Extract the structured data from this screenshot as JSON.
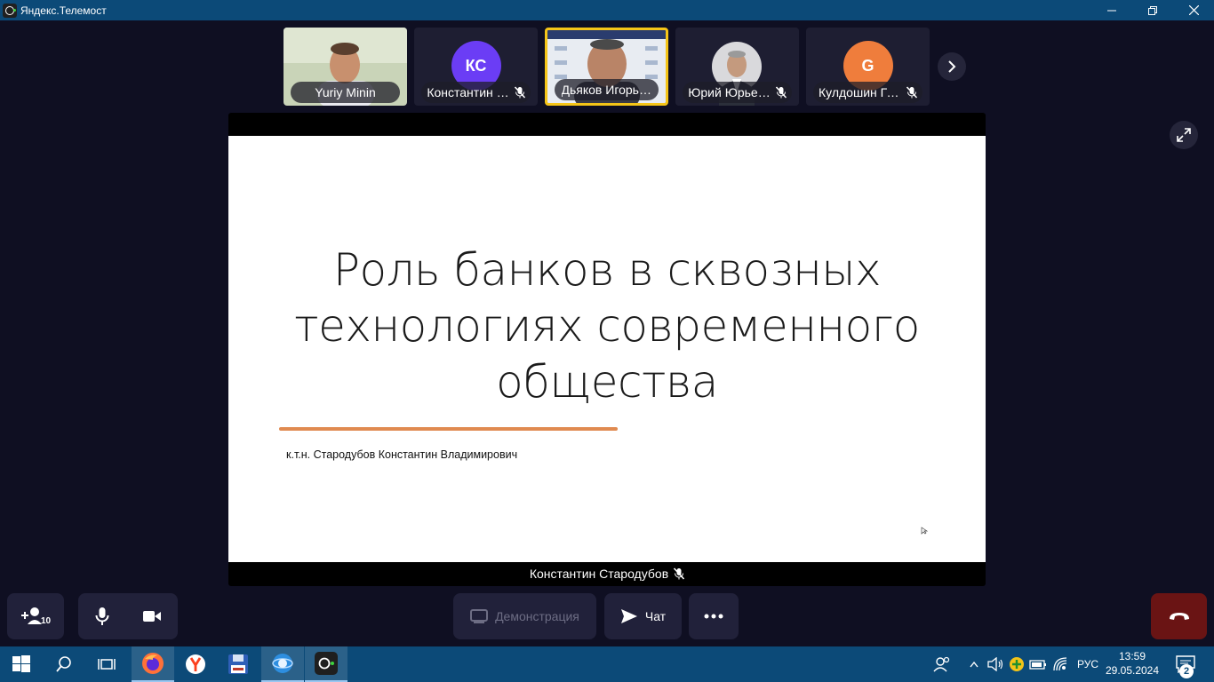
{
  "window": {
    "title": "Яндекс.Телемост"
  },
  "participants": [
    {
      "name": "Yuriy Minin",
      "type": "video",
      "muted": false
    },
    {
      "name": "Константин …",
      "type": "initials",
      "initials": "КС",
      "color": "#6b3df5",
      "muted": true
    },
    {
      "name": "Дьяков Игорь А…",
      "type": "video",
      "muted": false,
      "active": true
    },
    {
      "name": "Юрий  Юрье…",
      "type": "video",
      "muted": true
    },
    {
      "name": "Кулдошин Гр…",
      "type": "initials",
      "initials": "G",
      "color": "#ef7d3c",
      "muted": true
    }
  ],
  "slide": {
    "title_lines": [
      "Роль банков в сквозных",
      "технологиях современного",
      "общества"
    ],
    "author": "к.т.н. Стародубов Константин Владимирович",
    "accent_color": "#e08a50"
  },
  "presenter": {
    "name": "Константин Стародубов"
  },
  "controls": {
    "participants_count": "10",
    "demo_label": "Демонстрация",
    "chat_label": "Чат"
  },
  "taskbar": {
    "language": "РУС",
    "time": "13:59",
    "date": "29.05.2024",
    "notifications": "2"
  }
}
